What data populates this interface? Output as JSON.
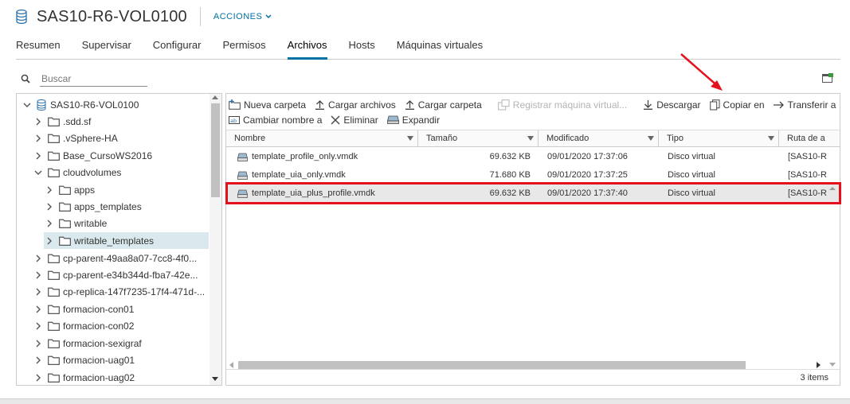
{
  "header": {
    "title": "SAS10-R6-VOL0100",
    "actions_label": "ACCIONES"
  },
  "tabs": [
    {
      "label": "Resumen"
    },
    {
      "label": "Supervisar"
    },
    {
      "label": "Configurar"
    },
    {
      "label": "Permisos"
    },
    {
      "label": "Archivos",
      "active": true
    },
    {
      "label": "Hosts"
    },
    {
      "label": "Máquinas virtuales"
    }
  ],
  "search": {
    "placeholder": "Buscar"
  },
  "tree": {
    "items": [
      {
        "label": "SAS10-R6-VOL0100"
      },
      {
        "label": ".sdd.sf"
      },
      {
        "label": ".vSphere-HA"
      },
      {
        "label": "Base_CursoWS2016"
      },
      {
        "label": "cloudvolumes"
      },
      {
        "label": "apps"
      },
      {
        "label": "apps_templates"
      },
      {
        "label": "writable"
      },
      {
        "label": "writable_templates"
      },
      {
        "label": "cp-parent-49aa8a07-7cc8-4f0..."
      },
      {
        "label": "cp-parent-e34b344d-fba7-42e..."
      },
      {
        "label": "cp-replica-147f7235-17f4-471d-..."
      },
      {
        "label": "formacion-con01"
      },
      {
        "label": "formacion-con02"
      },
      {
        "label": "formacion-sexigraf"
      },
      {
        "label": "formacion-uag01"
      },
      {
        "label": "formacion-uag02"
      }
    ]
  },
  "toolbar": {
    "new_folder": "Nueva carpeta",
    "upload_files": "Cargar archivos",
    "upload_folder": "Cargar carpeta",
    "register_vm": "Registrar máquina virtual...",
    "download": "Descargar",
    "copy_to": "Copiar en",
    "move_to": "Transferir a",
    "rename": "Cambiar nombre a",
    "delete": "Eliminar",
    "inflate": "Expandir"
  },
  "grid": {
    "columns": [
      "Nombre",
      "Tamaño",
      "Modificado",
      "Tipo",
      "Ruta de a"
    ],
    "rows": [
      {
        "name": "template_profile_only.vmdk",
        "size": "69.632 KB",
        "modified": "09/01/2020 17:37:06",
        "type": "Disco virtual",
        "path": "[SAS10-R"
      },
      {
        "name": "template_uia_only.vmdk",
        "size": "71.680 KB",
        "modified": "09/01/2020 17:37:25",
        "type": "Disco virtual",
        "path": "[SAS10-R"
      },
      {
        "name": "template_uia_plus_profile.vmdk",
        "size": "69.632 KB",
        "modified": "09/01/2020 17:37:40",
        "type": "Disco virtual",
        "path": "[SAS10-R"
      }
    ],
    "items_count": "3 items"
  },
  "colors": {
    "accent": "#0072a3",
    "highlight_box": "#e2111b",
    "selected_row": "#e8e8e8",
    "selected_tree": "#d9e9ee"
  }
}
